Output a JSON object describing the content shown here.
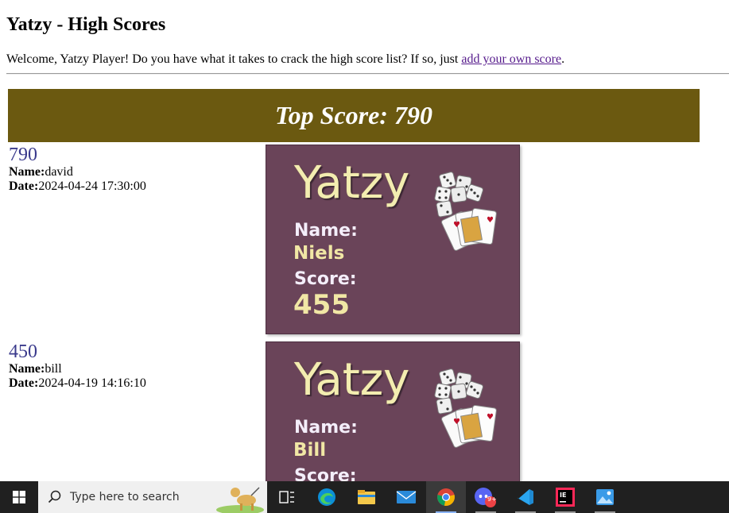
{
  "page": {
    "heading": "Yatzy - High Scores",
    "welcome_text": "Welcome, Yatzy Player! Do you have what it takes to crack the high score list? If so, just ",
    "welcome_link": "add your own score",
    "welcome_end": "."
  },
  "banner": {
    "text": "Top Score: 790"
  },
  "entries": [
    {
      "score": "790",
      "name_label": "Name:",
      "name": "david",
      "date_label": "Date:",
      "date": "2024-04-24 17:30:00",
      "card": {
        "title": "Yatzy",
        "name_label": "Name:",
        "name": "Niels",
        "score_label": "Score:",
        "score": "455"
      }
    },
    {
      "score": "450",
      "name_label": "Name:",
      "name": "bill",
      "date_label": "Date:",
      "date": "2024-04-19 14:16:10",
      "card": {
        "title": "Yatzy",
        "name_label": "Name:",
        "name": "Bill",
        "score_label": "Score:",
        "score": ""
      }
    }
  ],
  "taskbar": {
    "search_placeholder": "Type here to search",
    "icons": [
      "windows-start-icon",
      "task-view-icon",
      "edge-icon",
      "file-explorer-icon",
      "mail-icon",
      "chrome-icon",
      "discord-icon",
      "vscode-icon",
      "intellij-icon",
      "photos-icon"
    ],
    "discord_badge": "9+"
  },
  "colors": {
    "banner": "#6b5910",
    "card": "#6a4459",
    "link": "#551a8b",
    "score": "#3a3a8c"
  }
}
